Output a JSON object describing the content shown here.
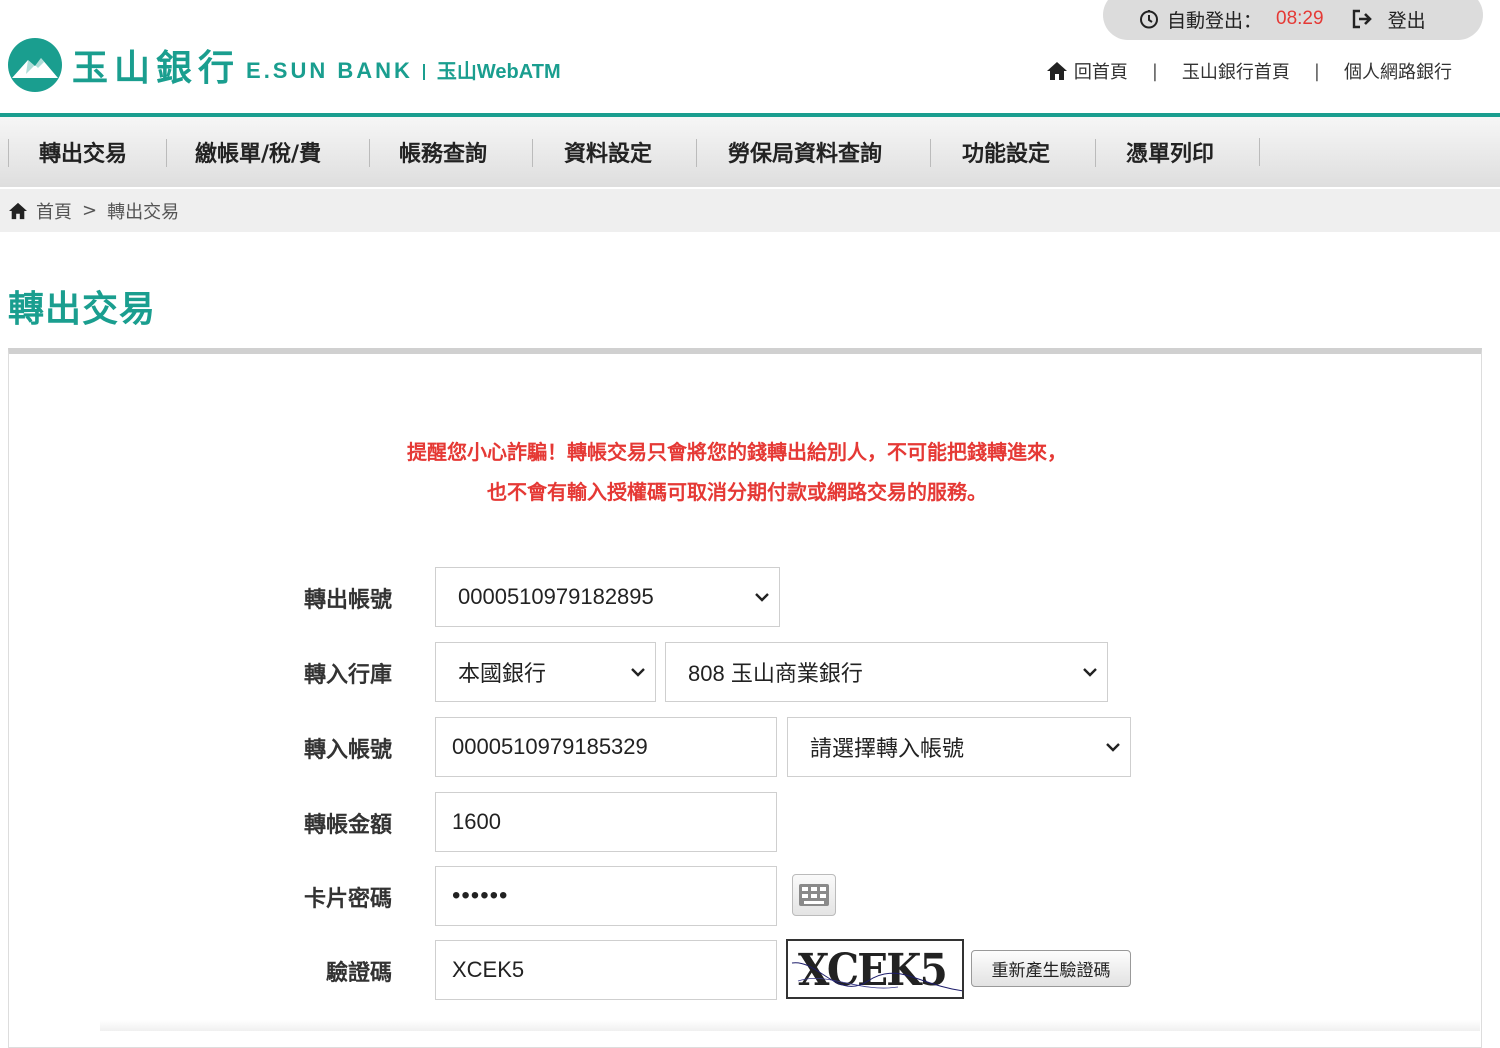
{
  "header": {
    "logo_cn": "玉山銀行",
    "logo_en": "E.SUN BANK",
    "logo_product": "玉山WebATM",
    "session": {
      "auto_logout_label": "自動登出：",
      "countdown": "08:29",
      "logout_label": "登出"
    },
    "links": {
      "home": "回首頁",
      "bank_home": "玉山銀行首頁",
      "personal_banking": "個人網路銀行"
    },
    "accent_color": "#1a9e8f"
  },
  "nav": {
    "items": [
      {
        "label": "轉出交易"
      },
      {
        "label": "繳帳單/稅/費"
      },
      {
        "label": "帳務查詢"
      },
      {
        "label": "資料設定"
      },
      {
        "label": "勞保局資料查詢"
      },
      {
        "label": "功能設定"
      },
      {
        "label": "憑單列印"
      }
    ]
  },
  "breadcrumb": {
    "home": "首頁",
    "separator": ">",
    "current": "轉出交易"
  },
  "page": {
    "title": "轉出交易",
    "warning_line1": "提醒您小心詐騙！轉帳交易只會將您的錢轉出給別人，不可能把錢轉進來，",
    "warning_line2": "也不會有輸入授權碼可取消分期付款或網路交易的服務。",
    "warning_color": "#e53935"
  },
  "form": {
    "from_account": {
      "label": "轉出帳號",
      "value": "0000510979182895"
    },
    "to_bank": {
      "label": "轉入行庫",
      "type_value": "本國銀行",
      "bank_value": "808 玉山商業銀行"
    },
    "to_account": {
      "label": "轉入帳號",
      "value": "0000510979185329",
      "select_value": "請選擇轉入帳號"
    },
    "amount": {
      "label": "轉帳金額",
      "value": "1600"
    },
    "card_password": {
      "label": "卡片密碼",
      "value": "••••••"
    },
    "captcha": {
      "label": "驗證碼",
      "value": "XCEK5",
      "image_text": "XCEK5",
      "regenerate_label": "重新產生驗證碼"
    }
  }
}
